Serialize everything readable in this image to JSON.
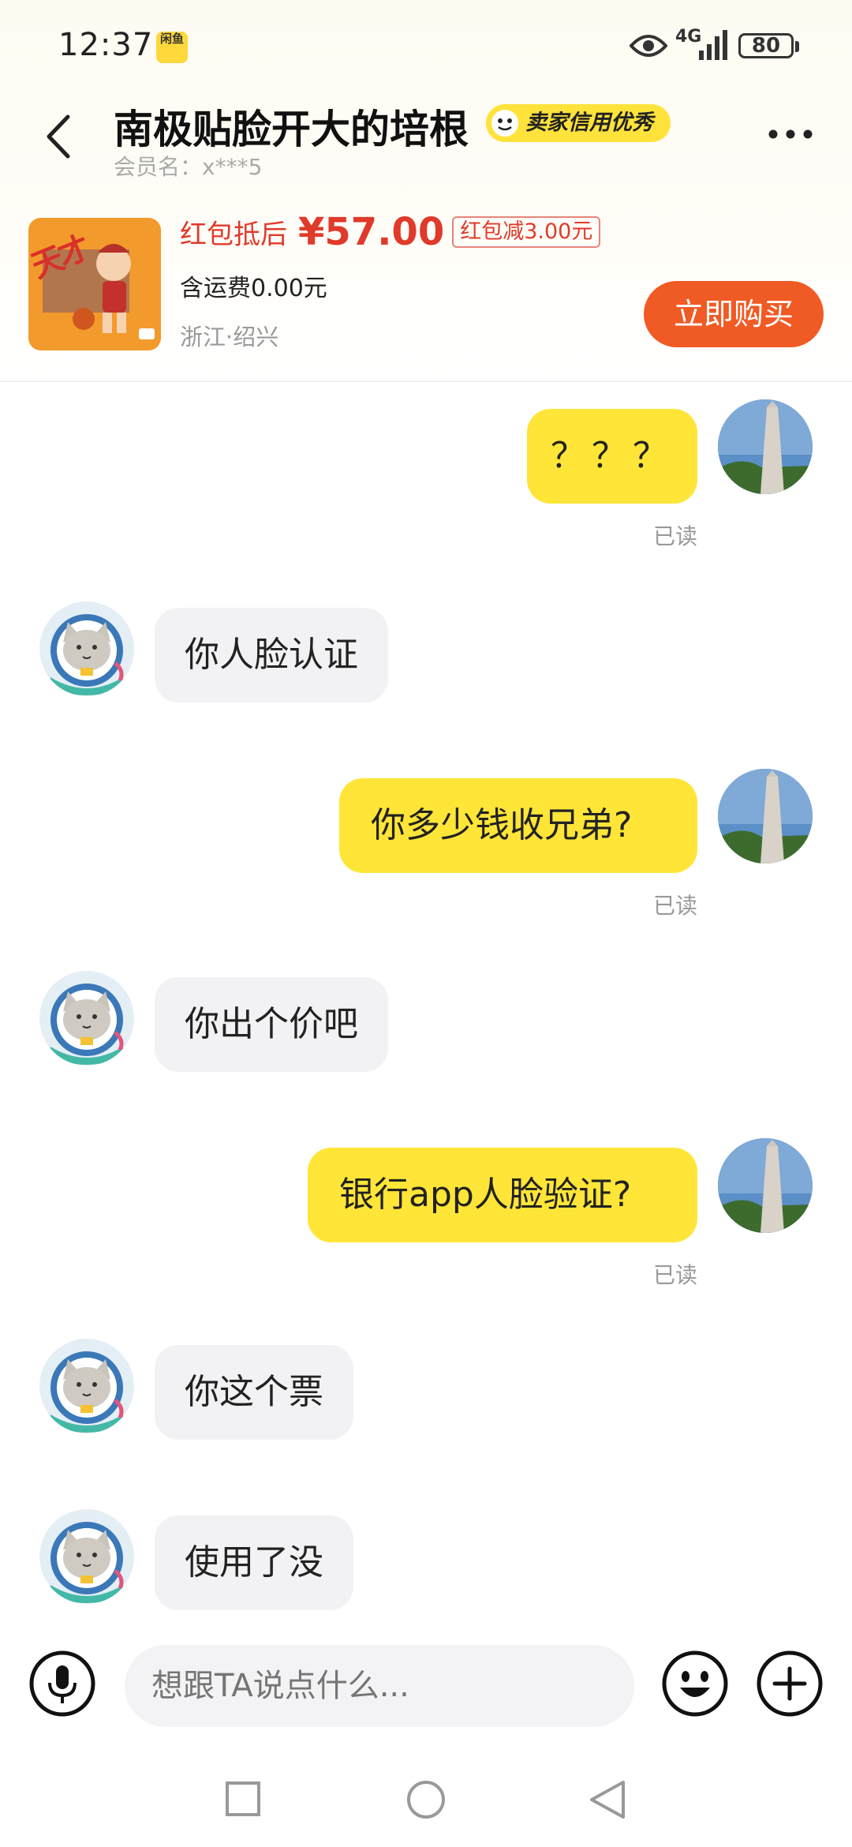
{
  "status_bar": {
    "time": "12:37",
    "app_badge_label": "闲鱼",
    "network": "4G",
    "battery": "80"
  },
  "header": {
    "seller_name": "南极贴脸开大的培根",
    "credit_badge": "卖家信用优秀",
    "member_label": "会员名：",
    "member_id": "x***5"
  },
  "product": {
    "price_prefix": "红包抵后",
    "price": "¥57.00",
    "discount_tag": "红包减3.00元",
    "shipping": "含运费0.00元",
    "location": "浙江·绍兴",
    "buy_label": "立即购买",
    "thumb_text": "天才"
  },
  "messages": [
    {
      "sender": "me",
      "text": "？？？",
      "status": "已读"
    },
    {
      "sender": "them",
      "text": "你人脸认证"
    },
    {
      "sender": "me",
      "text": "你多少钱收兄弟?",
      "status": "已读"
    },
    {
      "sender": "them",
      "text": "你出个价吧"
    },
    {
      "sender": "me",
      "text": "银行app人脸验证?",
      "status": "已读"
    },
    {
      "sender": "them",
      "text": "你这个票"
    },
    {
      "sender": "them",
      "text": "使用了没"
    }
  ],
  "input": {
    "placeholder": "想跟TA说点什么..."
  },
  "icons": {
    "back": "chevron-left-icon",
    "more": "more-dots-icon",
    "mic": "microphone-icon",
    "emoji": "emoji-icon",
    "plus": "plus-icon"
  },
  "colors": {
    "accent_yellow": "#ffe538",
    "buy_orange": "#f05a24",
    "price_red": "#e03a2a"
  }
}
